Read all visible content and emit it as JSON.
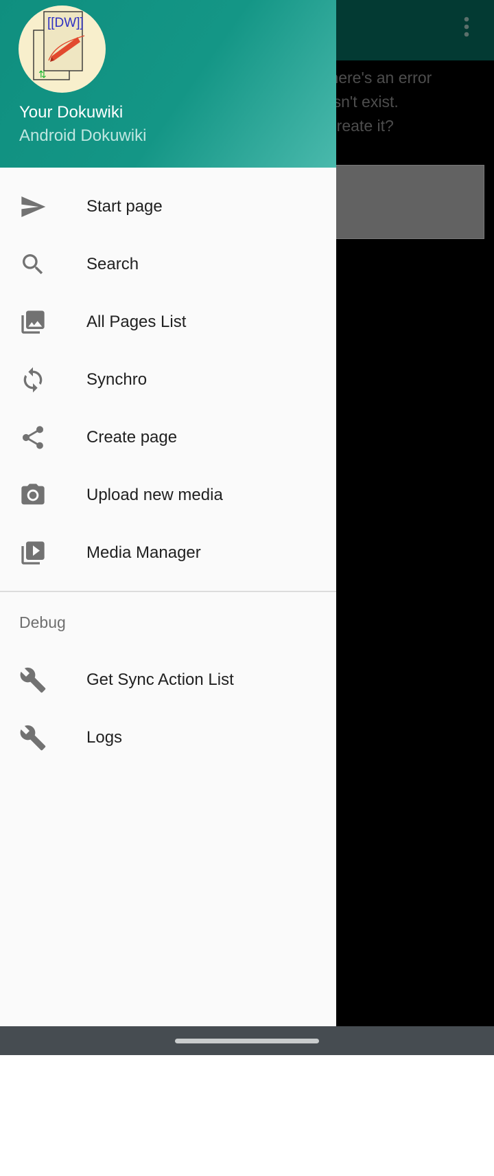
{
  "background": {
    "message": "r there's an error\noesn't exist.\no create it?",
    "overflow_icon": "more-vert-icon"
  },
  "drawer": {
    "header": {
      "logo_text": "[[DW]]",
      "title": "Your Dokuwiki",
      "subtitle": "Android Dokuwiki"
    },
    "items": [
      {
        "label": "Start page",
        "icon": "send-icon"
      },
      {
        "label": "Search",
        "icon": "search-icon"
      },
      {
        "label": "All Pages List",
        "icon": "photo-library-icon"
      },
      {
        "label": "Synchro",
        "icon": "sync-icon"
      },
      {
        "label": "Create page",
        "icon": "share-icon"
      },
      {
        "label": "Upload new media",
        "icon": "camera-icon"
      },
      {
        "label": "Media Manager",
        "icon": "video-library-icon"
      }
    ],
    "debug_section": {
      "label": "Debug",
      "items": [
        {
          "label": "Get Sync Action List",
          "icon": "wrench-icon"
        },
        {
          "label": "Logs",
          "icon": "wrench-icon"
        }
      ]
    }
  },
  "colors": {
    "header_teal": "#149686",
    "icon_gray": "#727272",
    "nav_bar": "#464c51"
  }
}
